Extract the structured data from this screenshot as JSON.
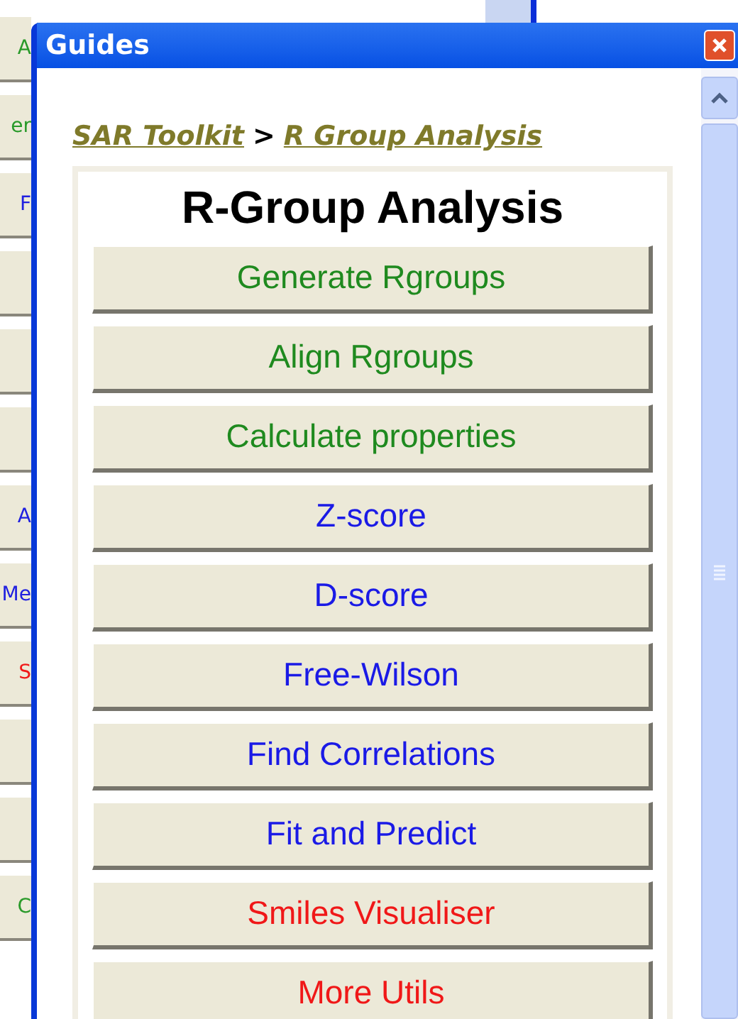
{
  "background_window": {
    "buttons": [
      {
        "kind": "text",
        "label": "A",
        "color": "#2a9a2a"
      },
      {
        "kind": "text",
        "label": "er",
        "color": "#2a9a2a"
      },
      {
        "kind": "text",
        "label": "F",
        "color": "#2020e0"
      },
      {
        "kind": "blank"
      },
      {
        "kind": "blank"
      },
      {
        "kind": "blank"
      },
      {
        "kind": "text",
        "label": "A",
        "color": "#2020e0"
      },
      {
        "kind": "text",
        "label": "Me",
        "color": "#2020e0"
      },
      {
        "kind": "text",
        "label": "S",
        "color": "#f01818"
      },
      {
        "kind": "blank"
      },
      {
        "kind": "blank"
      },
      {
        "kind": "text",
        "label": "C",
        "color": "#2a9a2a"
      }
    ]
  },
  "window": {
    "title": "Guides"
  },
  "breadcrumb": [
    {
      "label": "SAR Toolkit"
    },
    {
      "label": "R Group Analysis"
    }
  ],
  "breadcrumb_separator": ">",
  "panel": {
    "title": "R-Group Analysis",
    "buttons": [
      {
        "label": "Generate Rgroups",
        "color": "#1f8a1f"
      },
      {
        "label": "Align Rgroups",
        "color": "#1f8a1f"
      },
      {
        "label": "Calculate properties",
        "color": "#1f8a1f"
      },
      {
        "label": "Z-score",
        "color": "#1a1ae6"
      },
      {
        "label": "D-score",
        "color": "#1a1ae6"
      },
      {
        "label": "Free-Wilson",
        "color": "#1a1ae6"
      },
      {
        "label": "Find Correlations",
        "color": "#1a1ae6"
      },
      {
        "label": "Fit and Predict",
        "color": "#1a1ae6"
      },
      {
        "label": "Smiles Visualiser",
        "color": "#f01818"
      },
      {
        "label": "More Utils",
        "color": "#f01818"
      }
    ]
  }
}
